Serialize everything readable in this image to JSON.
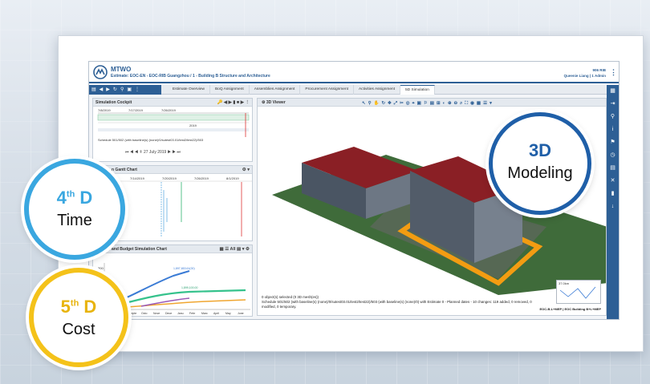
{
  "app": {
    "brand": "MTWO",
    "breadcrumb": "Estimate: EOC-EN - EOC-RIB Guangzhou / 1 - Building B Structure and Architecture",
    "user_line1": "906 RIB",
    "user_line2": "Queenie Liang | 1 Admin"
  },
  "tabs": [
    {
      "label": "Estimate Overview",
      "active": false
    },
    {
      "label": "BoQ Assignment",
      "active": false
    },
    {
      "label": "Assemblies Assignment",
      "active": false
    },
    {
      "label": "Procurement Assignment",
      "active": false
    },
    {
      "label": "Activities Assignment",
      "active": false
    },
    {
      "label": "5D Simulation",
      "active": true
    }
  ],
  "cockpit": {
    "title": "Simulation Cockpit",
    "dates": [
      "7/8/2019",
      "7/17/2019",
      "7/26/2019"
    ],
    "mid_date": "2019",
    "schedule_text": "Schedule 501/502 (with baseline(s) (none)/0/sutest03.01/test2/test22)/503",
    "current_date": "27 July 2019"
  },
  "gantt": {
    "title": "n Gantt Chart",
    "dates": [
      "7/8/2019",
      "7/14/2019",
      "7/20/2019",
      "7/26/2019",
      "8/1/2019"
    ]
  },
  "budget": {
    "title": "and Budget Simulation Chart",
    "all_label": "All",
    "y_value": "300",
    "labels": [
      "1,897,653.61(00)",
      "1,899,100.00"
    ],
    "x_labels": [
      "July",
      "Augu",
      "Septe",
      "Octo",
      "Nove",
      "Dece",
      "Janu",
      "Febr",
      "Marc",
      "April",
      "May",
      "June"
    ]
  },
  "viewer": {
    "title": "3D Viewer",
    "status_line1": "0 object(s) selected (0 3D mesh(es))",
    "status_line2": "Schedule 501/502 (with baseline(s) (none)/0/sutest03.01/test2/test22)/503 (with baseline(s) (none)/0) with Estimate 0 - Planned dates - 10 changes: 119 added, 0 removed, 0",
    "status_line3": "modified, 0 temporary.",
    "minimap_label": "37.0km",
    "footer": "EOC-B-L+MEP | EOC Building B+L+MEP"
  },
  "badges": {
    "modeling_main": "3D",
    "modeling_label": "Modeling",
    "time_main": "4",
    "time_sup": "th",
    "time_suffix": " D",
    "time_label": "Time",
    "cost_main": "5",
    "cost_sup": "th",
    "cost_suffix": " D",
    "cost_label": "Cost"
  },
  "colors": {
    "brand_blue": "#2d5f95",
    "badge_3d": "#1f5fa8",
    "badge_4d": "#3aa7e0",
    "badge_5d": "#f4c21a"
  }
}
